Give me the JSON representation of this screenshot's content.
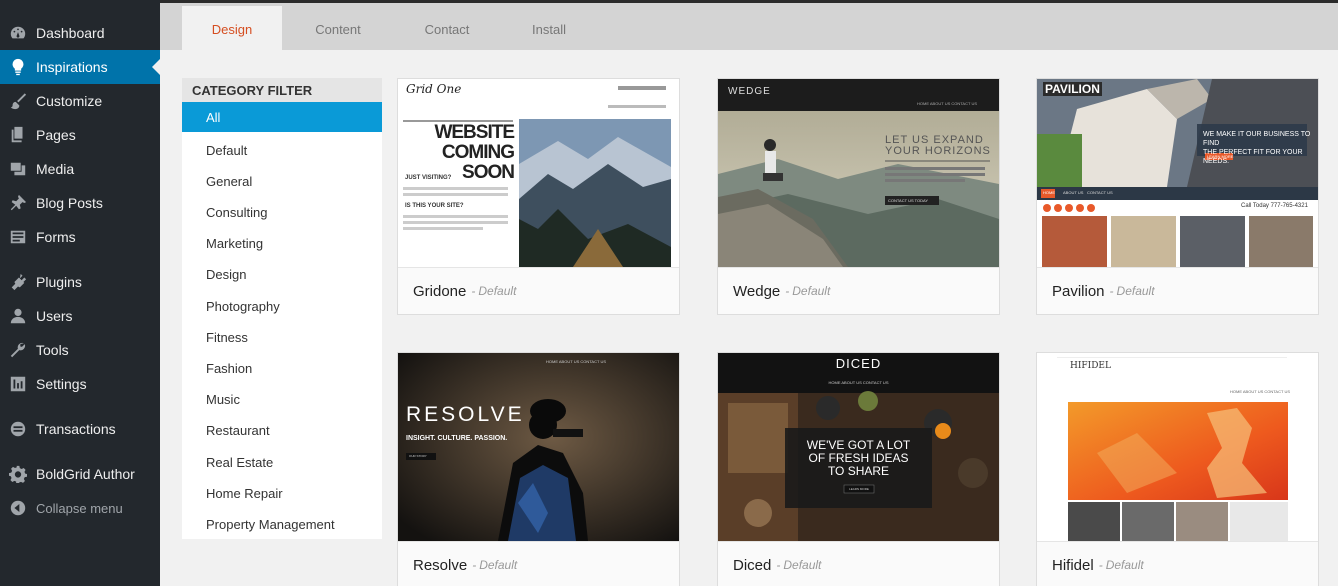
{
  "sidebar": {
    "items": [
      {
        "label": "Dashboard",
        "icon": "dashboard-icon"
      },
      {
        "label": "Inspirations",
        "icon": "lightbulb-icon"
      },
      {
        "label": "Customize",
        "icon": "brush-icon"
      },
      {
        "label": "Pages",
        "icon": "pages-icon"
      },
      {
        "label": "Media",
        "icon": "media-icon"
      },
      {
        "label": "Blog Posts",
        "icon": "pushpin-icon"
      },
      {
        "label": "Forms",
        "icon": "forms-icon"
      },
      {
        "label": "Plugins",
        "icon": "plugin-icon"
      },
      {
        "label": "Users",
        "icon": "users-icon"
      },
      {
        "label": "Tools",
        "icon": "wrench-icon"
      },
      {
        "label": "Settings",
        "icon": "settings-icon"
      },
      {
        "label": "Transactions",
        "icon": "transactions-icon"
      },
      {
        "label": "BoldGrid Author",
        "icon": "gear-icon"
      },
      {
        "label": "Collapse menu",
        "icon": "collapse-arrow-icon"
      }
    ],
    "active_index": 1
  },
  "tabs": [
    {
      "label": "Design",
      "active": true
    },
    {
      "label": "Content",
      "active": false
    },
    {
      "label": "Contact",
      "active": false
    },
    {
      "label": "Install",
      "active": false
    }
  ],
  "filter": {
    "heading": "CATEGORY FILTER",
    "items": [
      "All",
      "Default",
      "General",
      "Consulting",
      "Marketing",
      "Design",
      "Photography",
      "Fitness",
      "Fashion",
      "Music",
      "Restaurant",
      "Real Estate",
      "Home Repair",
      "Property Management"
    ],
    "selected": "All"
  },
  "themes": [
    {
      "name": "Gridone",
      "separator": "-",
      "category": "Default"
    },
    {
      "name": "Wedge",
      "separator": "-",
      "category": "Default"
    },
    {
      "name": "Pavilion",
      "separator": "-",
      "category": "Default"
    },
    {
      "name": "Resolve",
      "separator": "-",
      "category": "Default"
    },
    {
      "name": "Diced",
      "separator": "-",
      "category": "Default"
    },
    {
      "name": "Hifidel",
      "separator": "-",
      "category": "Default"
    }
  ],
  "previews": {
    "gridone": {
      "logo": "Grid One",
      "nav": "HOME   ABOUT US   CONTACT US",
      "heading1": "WEBSITE",
      "heading2": "COMING SOON",
      "sub1": "JUST VISITING?",
      "sub2": "IS THIS YOUR SITE?"
    },
    "wedge": {
      "logo": "WEDGE",
      "nav": "HOME   ABOUT US   CONTACT US",
      "line1": "LET US EXPAND",
      "line2": "YOUR HORIZONS",
      "button": "CONTACT US TODAY"
    },
    "pavilion": {
      "logo": "PAVILION",
      "tag1": "WE MAKE IT OUR BUSINESS TO FIND",
      "tag2": "THE PERFECT FIT FOR YOUR NEEDS.",
      "button": "LEARN MORE",
      "nav1": "HOME",
      "nav2": "ABOUT US",
      "nav3": "CONTACT US",
      "phone": "Call Today 777-765-4321"
    },
    "resolve": {
      "nav": "HOME   ABOUT US   CONTACT US",
      "title": "RESOLVE",
      "tagline": "INSIGHT. CULTURE. PASSION.",
      "button": "OUR STORY"
    },
    "diced": {
      "logo": "DICED",
      "nav": "HOME      ABOUT US      CONTACT US",
      "line1": "WE'VE GOT A LOT",
      "line2": "OF FRESH IDEAS",
      "line3": "TO SHARE",
      "button": "LEARN MORE"
    },
    "hifidel": {
      "logo": "HIFIDEL",
      "nav": "HOME   ABOUT US   CONTACT US"
    }
  },
  "colors": {
    "sidebar_bg": "#23282d",
    "active_nav": "#0073aa",
    "filter_selected": "#0a9ad7",
    "active_tab_text": "#d54e21"
  }
}
